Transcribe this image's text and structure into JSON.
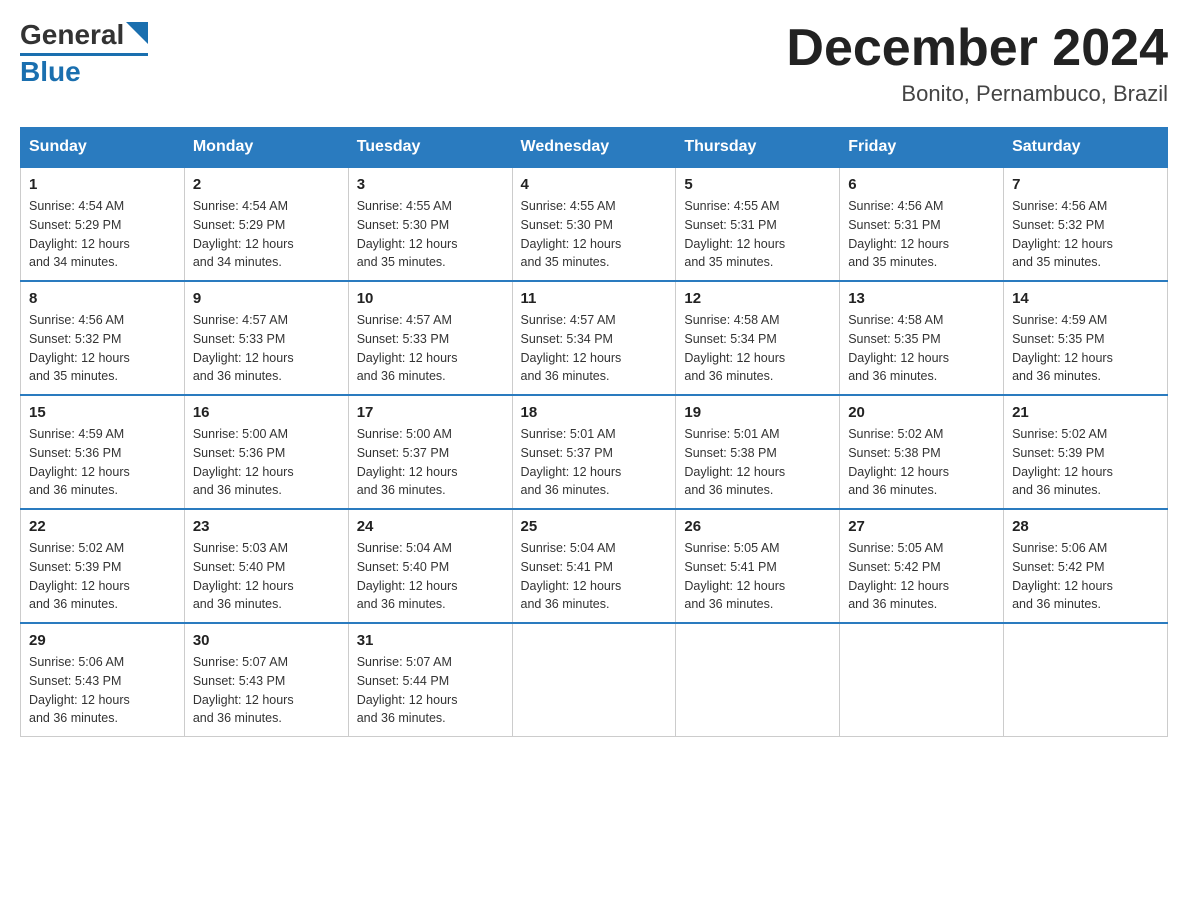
{
  "logo": {
    "text_general": "General",
    "text_blue": "Blue"
  },
  "title": {
    "month_year": "December 2024",
    "location": "Bonito, Pernambuco, Brazil"
  },
  "headers": [
    "Sunday",
    "Monday",
    "Tuesday",
    "Wednesday",
    "Thursday",
    "Friday",
    "Saturday"
  ],
  "weeks": [
    [
      {
        "day": "1",
        "sunrise": "4:54 AM",
        "sunset": "5:29 PM",
        "daylight": "12 hours and 34 minutes."
      },
      {
        "day": "2",
        "sunrise": "4:54 AM",
        "sunset": "5:29 PM",
        "daylight": "12 hours and 34 minutes."
      },
      {
        "day": "3",
        "sunrise": "4:55 AM",
        "sunset": "5:30 PM",
        "daylight": "12 hours and 35 minutes."
      },
      {
        "day": "4",
        "sunrise": "4:55 AM",
        "sunset": "5:30 PM",
        "daylight": "12 hours and 35 minutes."
      },
      {
        "day": "5",
        "sunrise": "4:55 AM",
        "sunset": "5:31 PM",
        "daylight": "12 hours and 35 minutes."
      },
      {
        "day": "6",
        "sunrise": "4:56 AM",
        "sunset": "5:31 PM",
        "daylight": "12 hours and 35 minutes."
      },
      {
        "day": "7",
        "sunrise": "4:56 AM",
        "sunset": "5:32 PM",
        "daylight": "12 hours and 35 minutes."
      }
    ],
    [
      {
        "day": "8",
        "sunrise": "4:56 AM",
        "sunset": "5:32 PM",
        "daylight": "12 hours and 35 minutes."
      },
      {
        "day": "9",
        "sunrise": "4:57 AM",
        "sunset": "5:33 PM",
        "daylight": "12 hours and 36 minutes."
      },
      {
        "day": "10",
        "sunrise": "4:57 AM",
        "sunset": "5:33 PM",
        "daylight": "12 hours and 36 minutes."
      },
      {
        "day": "11",
        "sunrise": "4:57 AM",
        "sunset": "5:34 PM",
        "daylight": "12 hours and 36 minutes."
      },
      {
        "day": "12",
        "sunrise": "4:58 AM",
        "sunset": "5:34 PM",
        "daylight": "12 hours and 36 minutes."
      },
      {
        "day": "13",
        "sunrise": "4:58 AM",
        "sunset": "5:35 PM",
        "daylight": "12 hours and 36 minutes."
      },
      {
        "day": "14",
        "sunrise": "4:59 AM",
        "sunset": "5:35 PM",
        "daylight": "12 hours and 36 minutes."
      }
    ],
    [
      {
        "day": "15",
        "sunrise": "4:59 AM",
        "sunset": "5:36 PM",
        "daylight": "12 hours and 36 minutes."
      },
      {
        "day": "16",
        "sunrise": "5:00 AM",
        "sunset": "5:36 PM",
        "daylight": "12 hours and 36 minutes."
      },
      {
        "day": "17",
        "sunrise": "5:00 AM",
        "sunset": "5:37 PM",
        "daylight": "12 hours and 36 minutes."
      },
      {
        "day": "18",
        "sunrise": "5:01 AM",
        "sunset": "5:37 PM",
        "daylight": "12 hours and 36 minutes."
      },
      {
        "day": "19",
        "sunrise": "5:01 AM",
        "sunset": "5:38 PM",
        "daylight": "12 hours and 36 minutes."
      },
      {
        "day": "20",
        "sunrise": "5:02 AM",
        "sunset": "5:38 PM",
        "daylight": "12 hours and 36 minutes."
      },
      {
        "day": "21",
        "sunrise": "5:02 AM",
        "sunset": "5:39 PM",
        "daylight": "12 hours and 36 minutes."
      }
    ],
    [
      {
        "day": "22",
        "sunrise": "5:02 AM",
        "sunset": "5:39 PM",
        "daylight": "12 hours and 36 minutes."
      },
      {
        "day": "23",
        "sunrise": "5:03 AM",
        "sunset": "5:40 PM",
        "daylight": "12 hours and 36 minutes."
      },
      {
        "day": "24",
        "sunrise": "5:04 AM",
        "sunset": "5:40 PM",
        "daylight": "12 hours and 36 minutes."
      },
      {
        "day": "25",
        "sunrise": "5:04 AM",
        "sunset": "5:41 PM",
        "daylight": "12 hours and 36 minutes."
      },
      {
        "day": "26",
        "sunrise": "5:05 AM",
        "sunset": "5:41 PM",
        "daylight": "12 hours and 36 minutes."
      },
      {
        "day": "27",
        "sunrise": "5:05 AM",
        "sunset": "5:42 PM",
        "daylight": "12 hours and 36 minutes."
      },
      {
        "day": "28",
        "sunrise": "5:06 AM",
        "sunset": "5:42 PM",
        "daylight": "12 hours and 36 minutes."
      }
    ],
    [
      {
        "day": "29",
        "sunrise": "5:06 AM",
        "sunset": "5:43 PM",
        "daylight": "12 hours and 36 minutes."
      },
      {
        "day": "30",
        "sunrise": "5:07 AM",
        "sunset": "5:43 PM",
        "daylight": "12 hours and 36 minutes."
      },
      {
        "day": "31",
        "sunrise": "5:07 AM",
        "sunset": "5:44 PM",
        "daylight": "12 hours and 36 minutes."
      },
      null,
      null,
      null,
      null
    ]
  ]
}
